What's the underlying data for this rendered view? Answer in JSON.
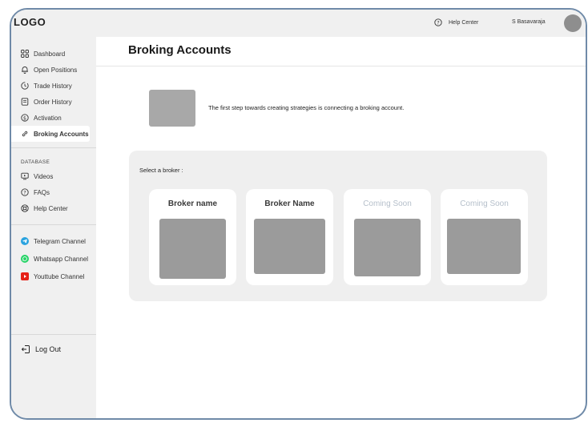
{
  "app": {
    "logo": "LOGO"
  },
  "sidebar": {
    "main_items": [
      {
        "label": "Dashboard",
        "icon": "dashboard-icon"
      },
      {
        "label": "Open Positions",
        "icon": "bell-icon"
      },
      {
        "label": "Trade History",
        "icon": "clock-icon"
      },
      {
        "label": "Order History",
        "icon": "document-icon"
      },
      {
        "label": "Activation",
        "icon": "dollar-icon"
      },
      {
        "label": "Broking Accounts",
        "icon": "link-icon",
        "active": true
      }
    ],
    "database_label": "DATABASE",
    "database_items": [
      {
        "label": "Videos",
        "icon": "video-icon"
      },
      {
        "label": "FAQs",
        "icon": "question-icon"
      },
      {
        "label": "Help Center",
        "icon": "support-icon"
      }
    ],
    "channels": [
      {
        "label": "Telegram Channel",
        "icon": "telegram-icon",
        "color": "#2aa3df"
      },
      {
        "label": "Whatsapp Channel",
        "icon": "whatsapp-icon",
        "color": "#25d366"
      },
      {
        "label": "Youttube Channel",
        "icon": "youtube-icon",
        "color": "#e62117"
      }
    ],
    "logout_label": "Log Out"
  },
  "topbar": {
    "help_label": "Help Center",
    "user_name": "S Basavaraja"
  },
  "page": {
    "title": "Broking Accounts",
    "info_text": "The first step towards creating strategies is connecting a broking account.",
    "select_label": "Select a broker :",
    "brokers": [
      {
        "name": "Broker name",
        "coming_soon": false
      },
      {
        "name": "Broker Name",
        "coming_soon": false
      },
      {
        "name": "Coming Soon",
        "coming_soon": true
      },
      {
        "name": "Coming Soon",
        "coming_soon": true
      }
    ]
  },
  "colors": {
    "accent_border": "#6f8aa8",
    "sidebar_bg": "#f0f0f0",
    "placeholder": "#9b9b9b"
  }
}
